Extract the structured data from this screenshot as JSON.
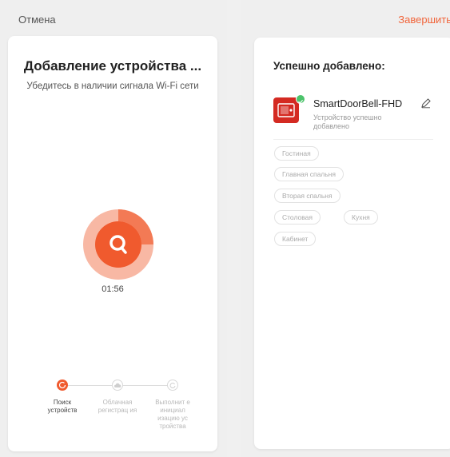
{
  "left_screen": {
    "cancel_label": "Отмена",
    "title": "Добавление устройства ...",
    "subtitle": "Убедитесь в наличии сигнала Wi-Fi сети",
    "timer": "01:56",
    "steps": [
      {
        "label": "Поиск устройств",
        "state": "active",
        "icon": "refresh-icon"
      },
      {
        "label": "Облачная регистрац ия",
        "state": "inactive",
        "icon": "cloud-icon"
      },
      {
        "label": "Выполнит е инициал изацию ус тройства",
        "state": "inactive",
        "icon": "refresh-icon"
      }
    ]
  },
  "right_screen": {
    "finish_label": "Завершить",
    "title": "Успешно добавлено:",
    "device": {
      "name": "SmartDoorBell-FHD",
      "status": "Устройство успешно добавлено",
      "icon": "doorbell-icon"
    },
    "rooms": [
      "Гостиная",
      "Главная спальня",
      "Вторая спальня",
      "Столовая",
      "Кухня",
      "Кабинет"
    ]
  },
  "colors": {
    "accent": "#f05a2e",
    "accent_light": "#f8b8a4",
    "finish_link": "#f1643a",
    "device_red": "#d42a22",
    "success_green": "#4cc36b"
  }
}
